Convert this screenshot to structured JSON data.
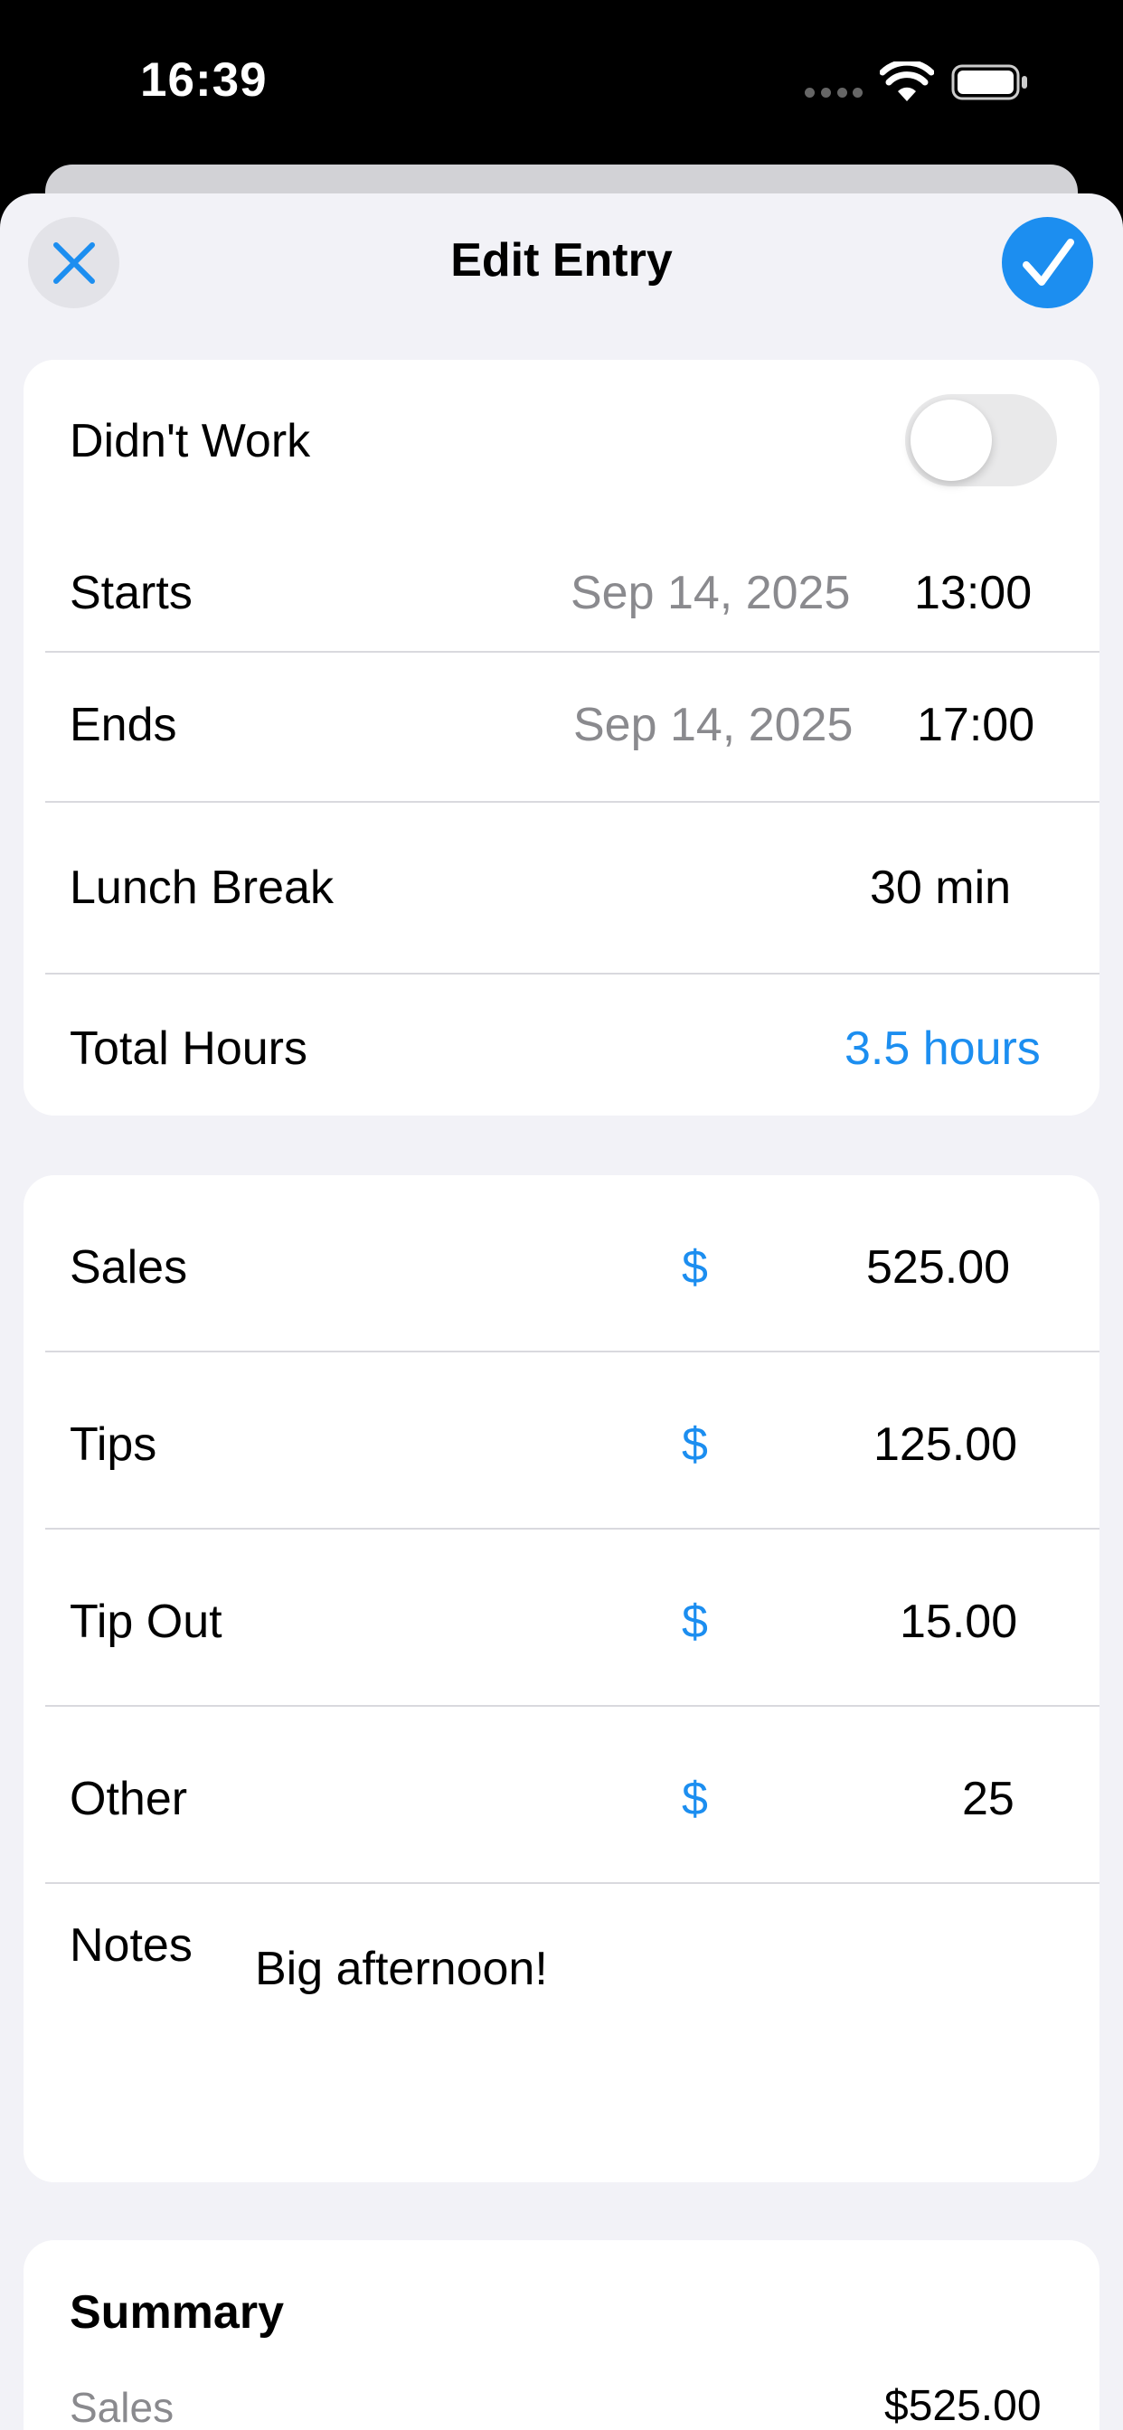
{
  "status_bar": {
    "time": "16:39"
  },
  "nav": {
    "title": "Edit Entry"
  },
  "entry": {
    "didnt_work_label": "Didn't Work",
    "didnt_work_on": false,
    "starts_label": "Starts",
    "starts_date": "Sep 14, 2025",
    "starts_time": "13:00",
    "ends_label": "Ends",
    "ends_date": "Sep 14, 2025",
    "ends_time": "17:00",
    "lunch_label": "Lunch Break",
    "lunch_value": "30 min",
    "total_label": "Total Hours",
    "total_value": "3.5 hours"
  },
  "money": {
    "currency_symbol": "$",
    "rows": [
      {
        "label": "Sales",
        "value": "525.00"
      },
      {
        "label": "Tips",
        "value": "125.00"
      },
      {
        "label": "Tip Out",
        "value": "15.00"
      },
      {
        "label": "Other",
        "value": "25"
      }
    ],
    "notes_label": "Notes",
    "notes_value": "Big afternoon!"
  },
  "summary": {
    "title": "Summary",
    "rows": [
      {
        "label": "Sales",
        "value": "$525.00"
      }
    ]
  },
  "colors": {
    "accent": "#1c8ef0",
    "background": "#f2f2f7",
    "card": "#ffffff",
    "muted_text": "#8a8a8e"
  },
  "icons": {
    "close": "xmark-icon",
    "done": "checkmark-icon",
    "wifi": "wifi-icon",
    "battery": "battery-icon"
  }
}
